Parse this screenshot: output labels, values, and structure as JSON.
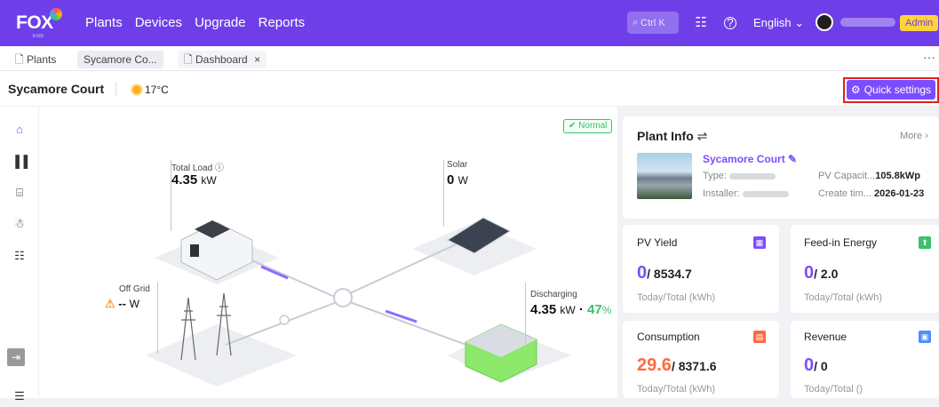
{
  "brand": {
    "logo": "FOX",
    "sub": "ESS"
  },
  "nav": [
    "Plants",
    "Devices",
    "Upgrade",
    "Reports"
  ],
  "header": {
    "search_placeholder": "Ctrl K",
    "language": "English",
    "role": "Admin"
  },
  "tabs": [
    {
      "label": "Plants"
    },
    {
      "label": "Sycamore Co..."
    },
    {
      "label": "Dashboard",
      "close": "×"
    }
  ],
  "tab_more": "···",
  "plant": {
    "name": "Sycamore Court",
    "temperature": "17°C"
  },
  "quick_settings": "Quick settings",
  "status": "Normal",
  "flow": {
    "total_load": {
      "label": "Total Load",
      "value": "4.35",
      "unit": "kW"
    },
    "solar": {
      "label": "Solar",
      "value": "0",
      "unit": "W"
    },
    "off_grid": {
      "label": "Off Grid",
      "value": "--",
      "unit": "W"
    },
    "battery": {
      "label": "Discharging",
      "value": "4.35",
      "unit": "kW",
      "soc": "47",
      "soc_unit": "%",
      "sep": "·"
    }
  },
  "plant_info": {
    "title": "Plant Info",
    "more": "More",
    "name": "Sycamore Court",
    "type_label": "Type:",
    "installer_label": "Installer:",
    "pv_capacity_label": "PV Capacit...",
    "pv_capacity": "105.8kWp",
    "create_label": "Create tim...",
    "create_time": "2026-01-23"
  },
  "cards": [
    {
      "title": "PV Yield",
      "today": "0",
      "total": "/ 8534.7",
      "sub": "Today/Total (kWh)",
      "color": "#7c4dff"
    },
    {
      "title": "Feed-in Energy",
      "today": "0",
      "total": "/ 2.0",
      "sub": "Today/Total (kWh)",
      "color": "#37c26b"
    },
    {
      "title": "Consumption",
      "today": "29.6",
      "total": "/ 8371.6",
      "sub": "Today/Total (kWh)",
      "color": "#ff6a3d"
    },
    {
      "title": "Revenue",
      "today": "0",
      "total": "/ 0",
      "sub": "Today/Total ()",
      "color": "#4d8dff"
    }
  ]
}
